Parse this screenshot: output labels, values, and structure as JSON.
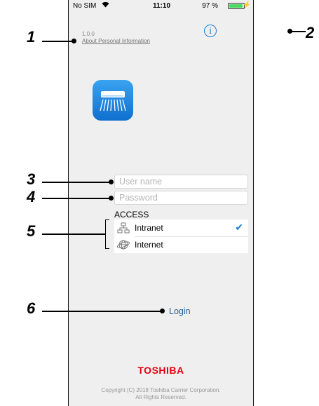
{
  "status_bar": {
    "carrier": "No SIM",
    "time": "11:10",
    "battery_percent": "97 %",
    "battery_level": 0.97
  },
  "header": {
    "version": "1.0.0",
    "privacy_link": "About Personal Information",
    "info_icon": "info-icon"
  },
  "app_icon": "air-conditioner-icon",
  "login_form": {
    "username_placeholder": "User name",
    "password_placeholder": "Password",
    "access_label": "ACCESS",
    "access_options": [
      {
        "label": "Intranet",
        "icon": "network-icon",
        "selected": true
      },
      {
        "label": "Internet",
        "icon": "globe-icon",
        "selected": false
      }
    ],
    "login_button": "Login"
  },
  "footer": {
    "brand": "TOSHIBA",
    "copyright_line1": "Copyright (C) 2018 Toshiba Carrier Corporation.",
    "copyright_line2": "All Rights Reserved."
  },
  "callouts": [
    "1",
    "2",
    "3",
    "4",
    "5",
    "6"
  ],
  "colors": {
    "accent": "#1a7fd9",
    "brand_red": "#e60012",
    "background": "#efefef"
  }
}
